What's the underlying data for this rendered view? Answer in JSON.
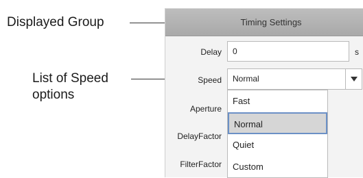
{
  "callouts": {
    "displayed_group": "Displayed Group",
    "speed_options_line1": "List of Speed",
    "speed_options_line2": "options"
  },
  "panel": {
    "title": "Timing Settings",
    "rows": {
      "delay_label": "Delay",
      "delay_value": "0",
      "delay_unit": "s",
      "speed_label": "Speed",
      "speed_value": "Normal",
      "aperture_label": "Aperture",
      "delayfactor_label": "DelayFactor",
      "filterfactor_label": "FilterFactor"
    },
    "speed_options": [
      "Fast",
      "Normal",
      "Quiet",
      "Custom"
    ],
    "selected_option": "Normal"
  },
  "colors": {
    "selection_border": "#6b90c6",
    "header": "#b3b3b3"
  }
}
